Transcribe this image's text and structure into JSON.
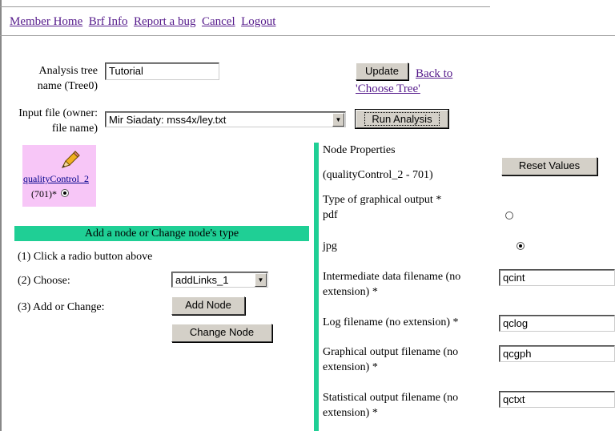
{
  "nav": {
    "links": [
      "Member Home",
      "Brf Info",
      "Report a bug",
      "Cancel",
      "Logout"
    ]
  },
  "form": {
    "tree_label_line1": "Analysis tree",
    "tree_label_line2": "name (Tree0)",
    "tree_value": "Tutorial",
    "update_label": "Update",
    "back_link_line1": "Back to",
    "back_link_line2": "'Choose Tree'",
    "input_label_line1": "Input file (owner:",
    "input_label_line2": "file name)",
    "input_value": "Mir Siadaty: mss4x/ley.txt",
    "run_label": "Run Analysis"
  },
  "node": {
    "name": "qualityControl_2",
    "id_text": "(701)*",
    "icon": "pencil-icon"
  },
  "add_section": {
    "title": "Add a node or Change node's type",
    "step1": "(1) Click a radio button above",
    "step2": "(2) Choose:",
    "choose_value": "addLinks_1",
    "step3": "(3) Add or Change:",
    "add_label": "Add Node",
    "change_label": "Change Node"
  },
  "properties": {
    "title": "Node Properties",
    "subtitle": "(qualityControl_2 - 701)",
    "reset_label": "Reset Values",
    "output_type_label": "Type of graphical output *",
    "opt_pdf": "pdf",
    "opt_jpg": "jpg",
    "selected": "jpg",
    "inter_label_line1": "Intermediate data filename (no",
    "inter_label_line2": "extension) *",
    "inter_value": "qcint",
    "log_label": "Log filename (no extension) *",
    "log_value": "qclog",
    "graph_label_line1": "Graphical output filename (no",
    "graph_label_line2": "extension) *",
    "graph_value": "qcgph",
    "stat_label_line1": "Statistical output filename (no",
    "stat_label_line2": "extension) *",
    "stat_value": "qctxt"
  },
  "colors": {
    "section_bar": "#1fcf95",
    "node_box": "#f7c6f7",
    "link": "#551a8b",
    "button_face": "#d4d0c8"
  }
}
